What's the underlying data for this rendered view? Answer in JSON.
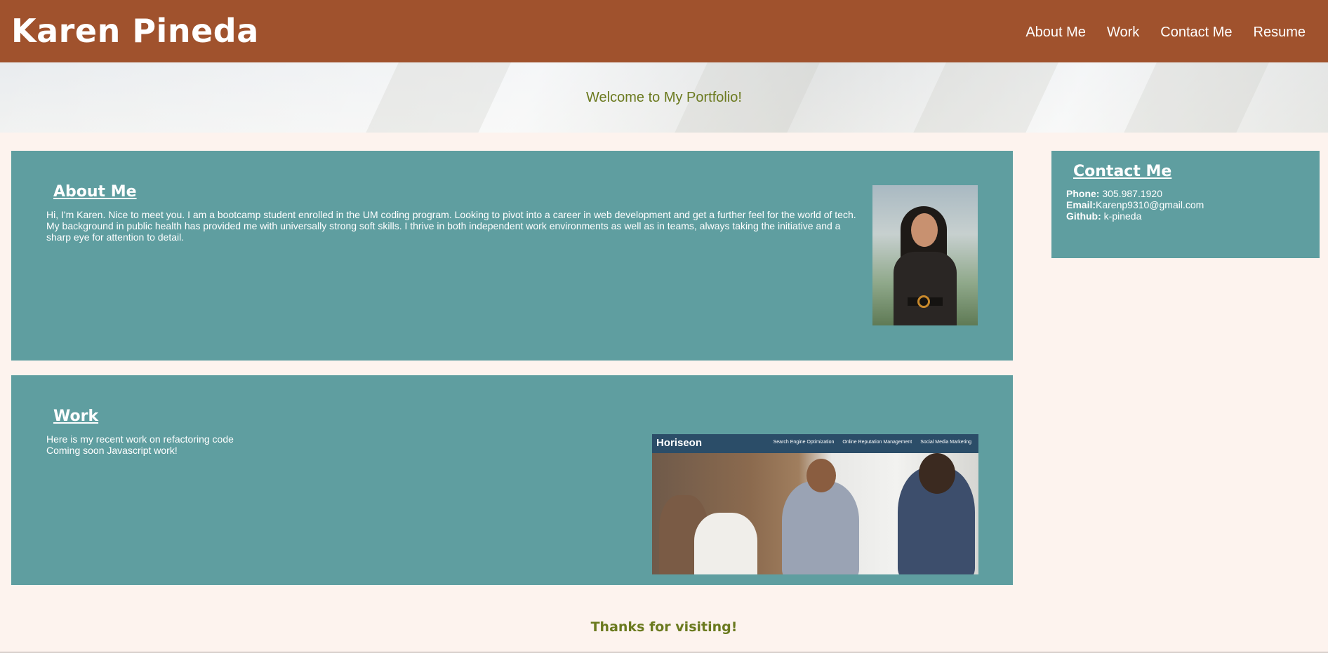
{
  "header": {
    "site_title": "Karen Pineda",
    "nav": [
      "About Me",
      "Work",
      "Contact Me",
      "Resume"
    ]
  },
  "hero": {
    "text": "Welcome to My Portfolio!"
  },
  "about": {
    "title": "About Me",
    "body": "Hi, I'm Karen. Nice to meet you. I am a bootcamp student enrolled in the UM coding program. Looking to pivot into a career in web development and get a further feel for the world of tech. My background in public health has provided me with universally strong soft skills. I thrive in both independent work environments as well as in teams, always taking the initiative and a sharp eye for attention to detail."
  },
  "work": {
    "title": "Work",
    "lines": [
      "Here is my recent work on refactoring code",
      "Coming soon Javascript work!"
    ],
    "project_screenshot": {
      "brand": "Horiseon",
      "links": [
        "Search Engine Optimization",
        "Online Reputation Management",
        "Social Media Marketing"
      ]
    }
  },
  "contact": {
    "title": "Contact Me",
    "phone_label": "Phone:",
    "phone_value": "305.987.1920",
    "email_label": "Email:",
    "email_value": "Karenp9310@gmail.com",
    "github_label": "Github:",
    "github_value": "k-pineda"
  },
  "footer": {
    "text": "Thanks for visiting!"
  },
  "colors": {
    "header_bg": "#a0522d",
    "card_bg": "#5f9ea0",
    "page_bg": "#fdf3ee",
    "accent_text": "#6b7a1f"
  }
}
